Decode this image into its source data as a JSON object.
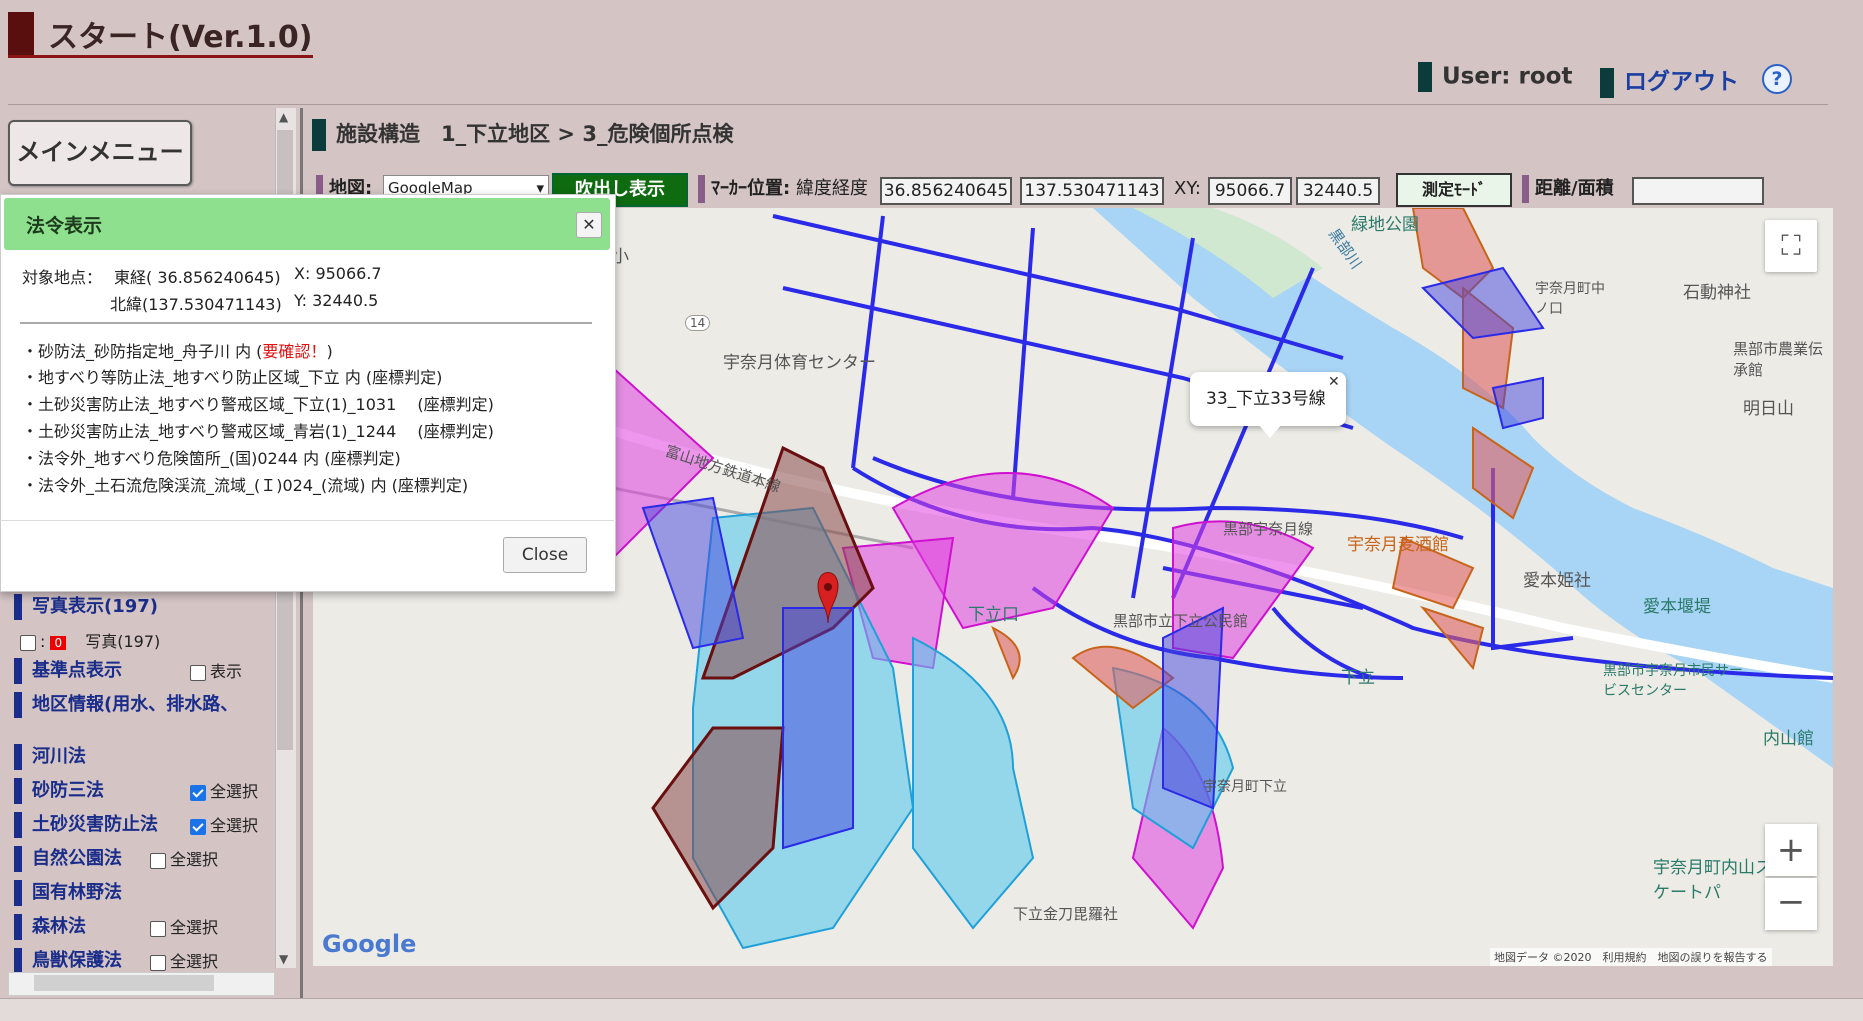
{
  "app": {
    "title": "スタート(Ver.1.0)",
    "user_label": "User: root",
    "logout_label": "ログアウト",
    "help_icon": "?"
  },
  "sidebar": {
    "main_menu_label": "メインメニュー",
    "items": [
      {
        "label": "写真表示(197)"
      },
      {
        "label": "基準点表示",
        "check_label": "表示"
      },
      {
        "label": "地区情報(用水、排水路、"
      },
      {
        "label": "河川法"
      },
      {
        "label": "砂防三法",
        "check_label": "全選択"
      },
      {
        "label": "土砂災害防止法",
        "check_label": "全選択"
      },
      {
        "label": "自然公園法",
        "check_label": "全選択"
      },
      {
        "label": "国有林野法"
      },
      {
        "label": "森林法",
        "check_label": "全選択"
      },
      {
        "label": "鳥獣保護法",
        "check_label": "全選択"
      }
    ],
    "photo_row": {
      "colon": ":",
      "badge": "0",
      "label": "写真(197)"
    }
  },
  "breadcrumb": "施設構造　1_下立地区 > 3_危険個所点検",
  "toolbar": {
    "map_label": "地図:",
    "map_select_value": "GoogleMap",
    "fukidashi_label": "吹出し表示",
    "marker_label": "ﾏｰｶｰ位置:",
    "latlng_label": "緯度経度",
    "lat": "36.856240645",
    "lng": "137.530471143",
    "xy_label": "XY:",
    "x": "95066.7",
    "y": "32440.5",
    "measure_label": "測定ﾓｰﾄﾞ",
    "distance_label": "距離/面積",
    "distance_value": ""
  },
  "map": {
    "labels": [
      "宇奈月小",
      "宇奈月体育センター",
      "富山地方鉄道本線",
      "黒部宇奈月線",
      "宇奈月麦酒館",
      "愛本姫社",
      "愛本堰堤",
      "黒部市宇奈月市民サービスセンター",
      "下立口",
      "下立",
      "黒部市立下立公民館",
      "宇奈月町下立",
      "下立金刀毘羅社",
      "黒部川",
      "石動神社",
      "黒部市農業伝承館",
      "明日山",
      "宇奈月町中ノ口",
      "内山館",
      "宇奈月町内山スケートパ",
      "緑地公園",
      "14"
    ],
    "infowindow_text": "33_下立33号線",
    "attribution": "地図データ ©2020　利用規約　地図の誤りを報告する",
    "google_logo": "Google"
  },
  "dialog": {
    "title": "法令表示",
    "target_label": "対象地点：",
    "east_label": "東経( 36.856240645)",
    "x_label": "X: 95066.7",
    "north_label": "北緯(137.530471143)",
    "y_label": "Y: 32440.5",
    "lines": [
      {
        "text": "・砂防法_砂防指定地_舟子川 内 (",
        "warn": "要確認！",
        "tail": ")"
      },
      {
        "text": "・地すべり等防止法_地すべり防止区域_下立 内 (座標判定)"
      },
      {
        "text": "・土砂災害防止法_地すべり警戒区域_下立(1)_1031　 (座標判定)"
      },
      {
        "text": "・土砂災害防止法_地すべり警戒区域_青岩(1)_1244　 (座標判定)"
      },
      {
        "text": "・法令外_地すべり危険箇所_(国)0244 内 (座標判定)"
      },
      {
        "text": "・法令外_土石流危険渓流_流域_(Ｉ)024_(流域) 内 (座標判定)"
      }
    ],
    "close_label": "Close"
  },
  "colors": {
    "accent": "#1a2d8a",
    "header_bg": "#8ee08e",
    "fukidashi_bg": "#0f6b0f",
    "road_blue": "#2a2ae8",
    "zone_magenta": "#e040e0",
    "zone_red": "#e06060",
    "river": "#a8d4f5"
  }
}
